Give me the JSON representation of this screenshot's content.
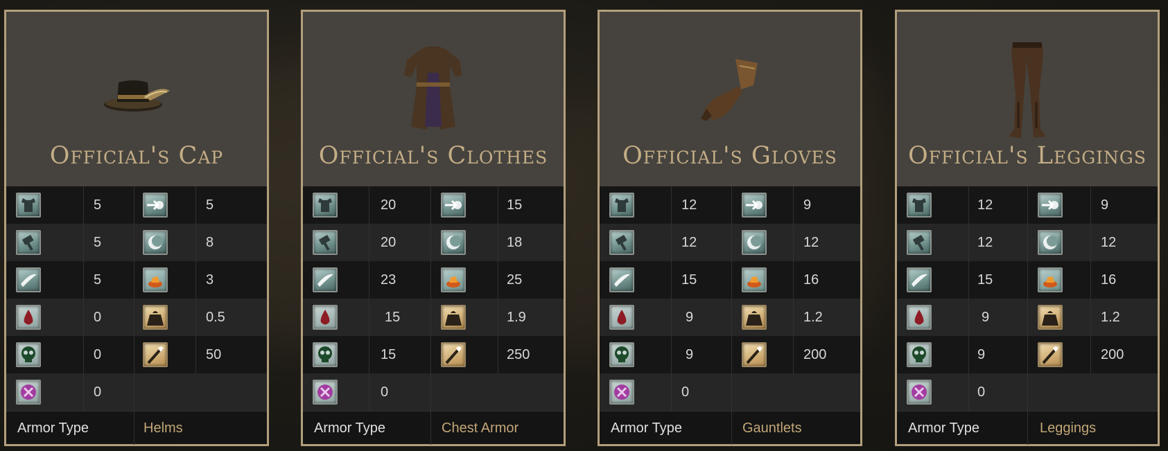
{
  "stat_icons": {
    "col1": [
      "physical-armor-icon",
      "strike-armor-icon",
      "slash-armor-icon",
      "bleed-resist-icon",
      "poison-resist-icon",
      "frost-resist-icon"
    ],
    "col2": [
      "magic-armor-icon",
      "moon-armor-icon",
      "fire-armor-icon",
      "weight-icon",
      "poise-icon"
    ]
  },
  "cards": [
    {
      "name": "Official's Cap",
      "col1": [
        "5",
        "5",
        "5",
        "0",
        "0",
        "0"
      ],
      "col2": [
        "5",
        "8",
        "3",
        "0.5",
        "50"
      ],
      "armor_type_label": "Armor Type",
      "armor_type": "Helms"
    },
    {
      "name": "Official's Clothes",
      "col1": [
        "20",
        "20",
        "23",
        "15",
        "15",
        "0"
      ],
      "col2": [
        "15",
        "18",
        "25",
        "1.9",
        "250"
      ],
      "armor_type_label": "Armor Type",
      "armor_type": "Chest Armor"
    },
    {
      "name": "Official's Gloves",
      "col1": [
        "12",
        "12",
        "15",
        "9",
        "9",
        "0"
      ],
      "col2": [
        "9",
        "12",
        "16",
        "1.2",
        "200"
      ],
      "armor_type_label": "Armor Type",
      "armor_type": "Gauntlets"
    },
    {
      "name": "Official's Leggings",
      "col1": [
        "12",
        "12",
        "15",
        "9",
        "9",
        "0"
      ],
      "col2": [
        "9",
        "12",
        "16",
        "1.2",
        "200"
      ],
      "armor_type_label": "Armor Type",
      "armor_type": "Leggings"
    }
  ],
  "colors": {
    "card_border": "#b39f7d",
    "title": "#c4ad86",
    "armor_type": "#c2a677",
    "header_bg": "#46433e"
  }
}
